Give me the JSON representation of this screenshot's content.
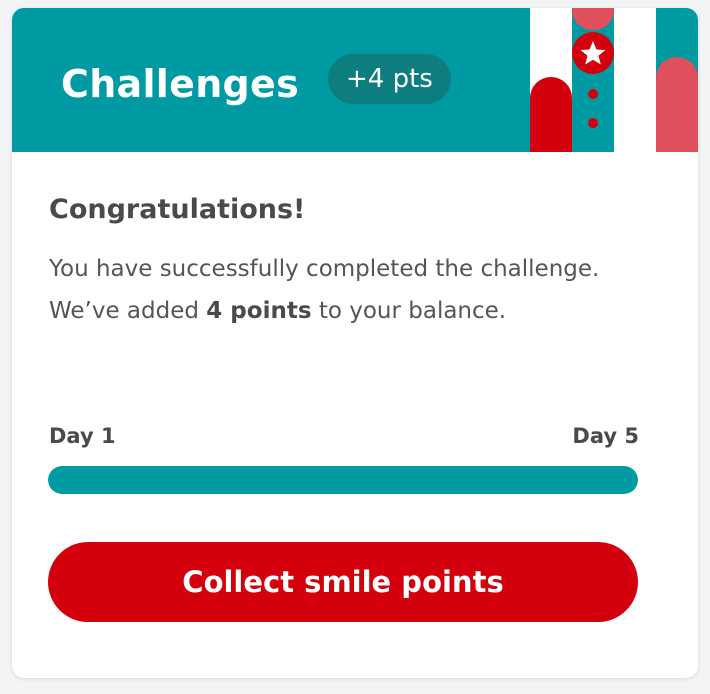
{
  "header": {
    "title": "Challenges",
    "badge": "+4 pts"
  },
  "body": {
    "heading": "Congratulations!",
    "message_before": "You have successfully completed the challenge. We’ve added ",
    "message_bold": "4 points",
    "message_after": " to your balance."
  },
  "progress": {
    "start_label": "Day 1",
    "end_label": "Day 5",
    "fraction": 1.0
  },
  "actions": {
    "collect_label": "Collect smile points"
  },
  "colors": {
    "header_bg": "#009aa2",
    "badge_bg": "#0d7d80",
    "accent_red": "#d4000d",
    "coral": "#e0505c",
    "progress_fill": "#009aa2"
  },
  "icons": {
    "badge_star": "star-icon"
  }
}
